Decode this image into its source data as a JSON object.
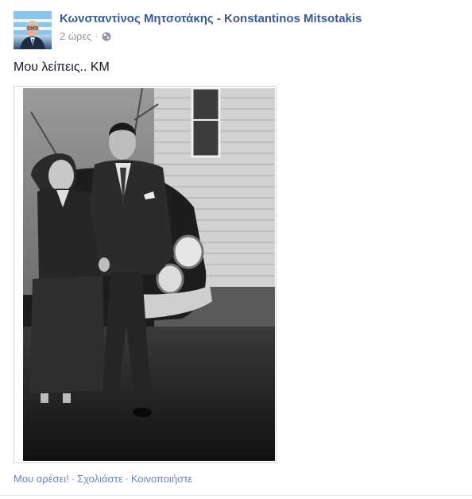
{
  "post": {
    "author": "Κωνσταντίνος Μητσοτάκης - Konstantinos Mitsotakis",
    "timestamp": "2 ώρες",
    "separator": "·",
    "audience_icon": "globe-icon",
    "message": "Μου λείπεις.. ΚΜ",
    "photo_icon": "black-and-white-photo"
  },
  "actions": {
    "like": "Μου αρέσει!",
    "comment": "Σχολιάστε",
    "share": "Κοινοποιήστε",
    "separator": "·"
  },
  "colors": {
    "link": "#3b5998",
    "action_link": "#6d84b4",
    "meta": "#9197a3",
    "text": "#141823"
  }
}
